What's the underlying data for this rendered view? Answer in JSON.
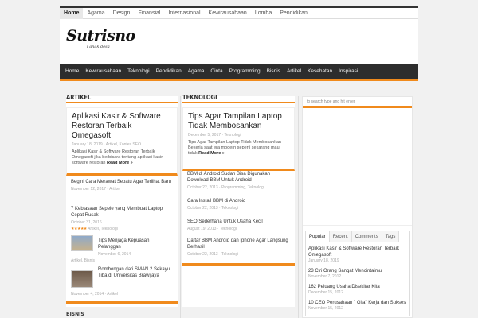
{
  "topnav": [
    "Home",
    "Agama",
    "Design",
    "Finansial",
    "Internasional",
    "Kewirausahaan",
    "Lomba",
    "Pendidikan"
  ],
  "logo": {
    "name": "Sutrisno",
    "tagline": "i anak desa"
  },
  "mainnav": [
    "Home",
    "Kewirausahaan",
    "Teknologi",
    "Pendidikan",
    "Agama",
    "Cinta",
    "Programming",
    "Bisnis",
    "Artikel",
    "Kesehatan",
    "Inspirasi"
  ],
  "artikel": {
    "heading": "Artikel",
    "featured": {
      "title": "Aplikasi Kasir & Software Restoran Terbaik Omegasoft",
      "meta": "January 18, 2019  ·  Artikel, Kontes SEO",
      "excerpt": "Aplikasi Kasir & Software Restoran Terbaik Omegasoft jika berbicara tentang aplikasi kasir software restoran",
      "readmore": "Read More »"
    },
    "items": [
      {
        "title": "Beginl Cara Merawat Sepatu Agar Terlihat Baru",
        "meta": "November 12, 2017  ·  Artikel"
      },
      {
        "title": "7 Kebiasaan Sepele yang Membuat Laptop Cepat Rusak",
        "meta": "October 31, 2016",
        "meta2": "Artikel, Teknologi",
        "stars": "★★★★★"
      },
      {
        "title": "Tips Menjaga Kepuasan Pelanggan",
        "meta": "November 6, 2014",
        "meta2": "Artikel, Bisnis"
      },
      {
        "title": "Rombongan dari SMAN 2 Sekayu Tiba di Universitas Brawijaya",
        "meta": "November 4, 2014  ·  Artikel"
      }
    ]
  },
  "teknologi": {
    "heading": "Teknologi",
    "featured": {
      "title": "Tips Agar Tampilan Laptop Tidak Membosankan",
      "meta": "December 5, 2017  ·  Teknologi",
      "excerpt": "Tips Agar Tampilan Laptop Tidak Membosankan Bekerja saat era modern seperti sekarang mau tidak",
      "readmore": "Read More »"
    },
    "items": [
      {
        "title": "BBM di Android Sudah Bisa Digunakan : Download BBM Untuk Android",
        "meta": "October 22, 2013  ·  Programming, Teknologi"
      },
      {
        "title": "Cara Install BBM di Android",
        "meta": "October 22, 2013  ·  Teknologi"
      },
      {
        "title": "SEO Sederhana Untuk Usaha Kecil",
        "meta": "August 19, 2013  ·  Teknologi"
      },
      {
        "title": "Daftar BBM Android dan Iphone Agar Langsung Berhasil",
        "meta": "October 22, 2013  ·  Teknologi"
      }
    ]
  },
  "sidebar": {
    "search_placeholder": "to search type and hit enter",
    "tabs": [
      "Popular",
      "Recent",
      "Comments",
      "Tags"
    ],
    "popular": [
      {
        "title": "Aplikasi Kasir & Software Restoran Terbaik Omegasoft",
        "date": "January 18, 2019"
      },
      {
        "title": "23 Ciri Orang Sangat Mencintaimu",
        "date": "November 7, 2012"
      },
      {
        "title": "162 Peluang Usaha Disekitar Kita",
        "date": "December 15, 2012"
      },
      {
        "title": "10 CEO Perusahaan \" Gila\" Kerja dan Sukses",
        "date": "November 15, 2012"
      }
    ]
  },
  "bisnis_heading": "Bisnis",
  "colors": {
    "accent": "#f08a1c",
    "navbg": "#2d2d2d"
  }
}
